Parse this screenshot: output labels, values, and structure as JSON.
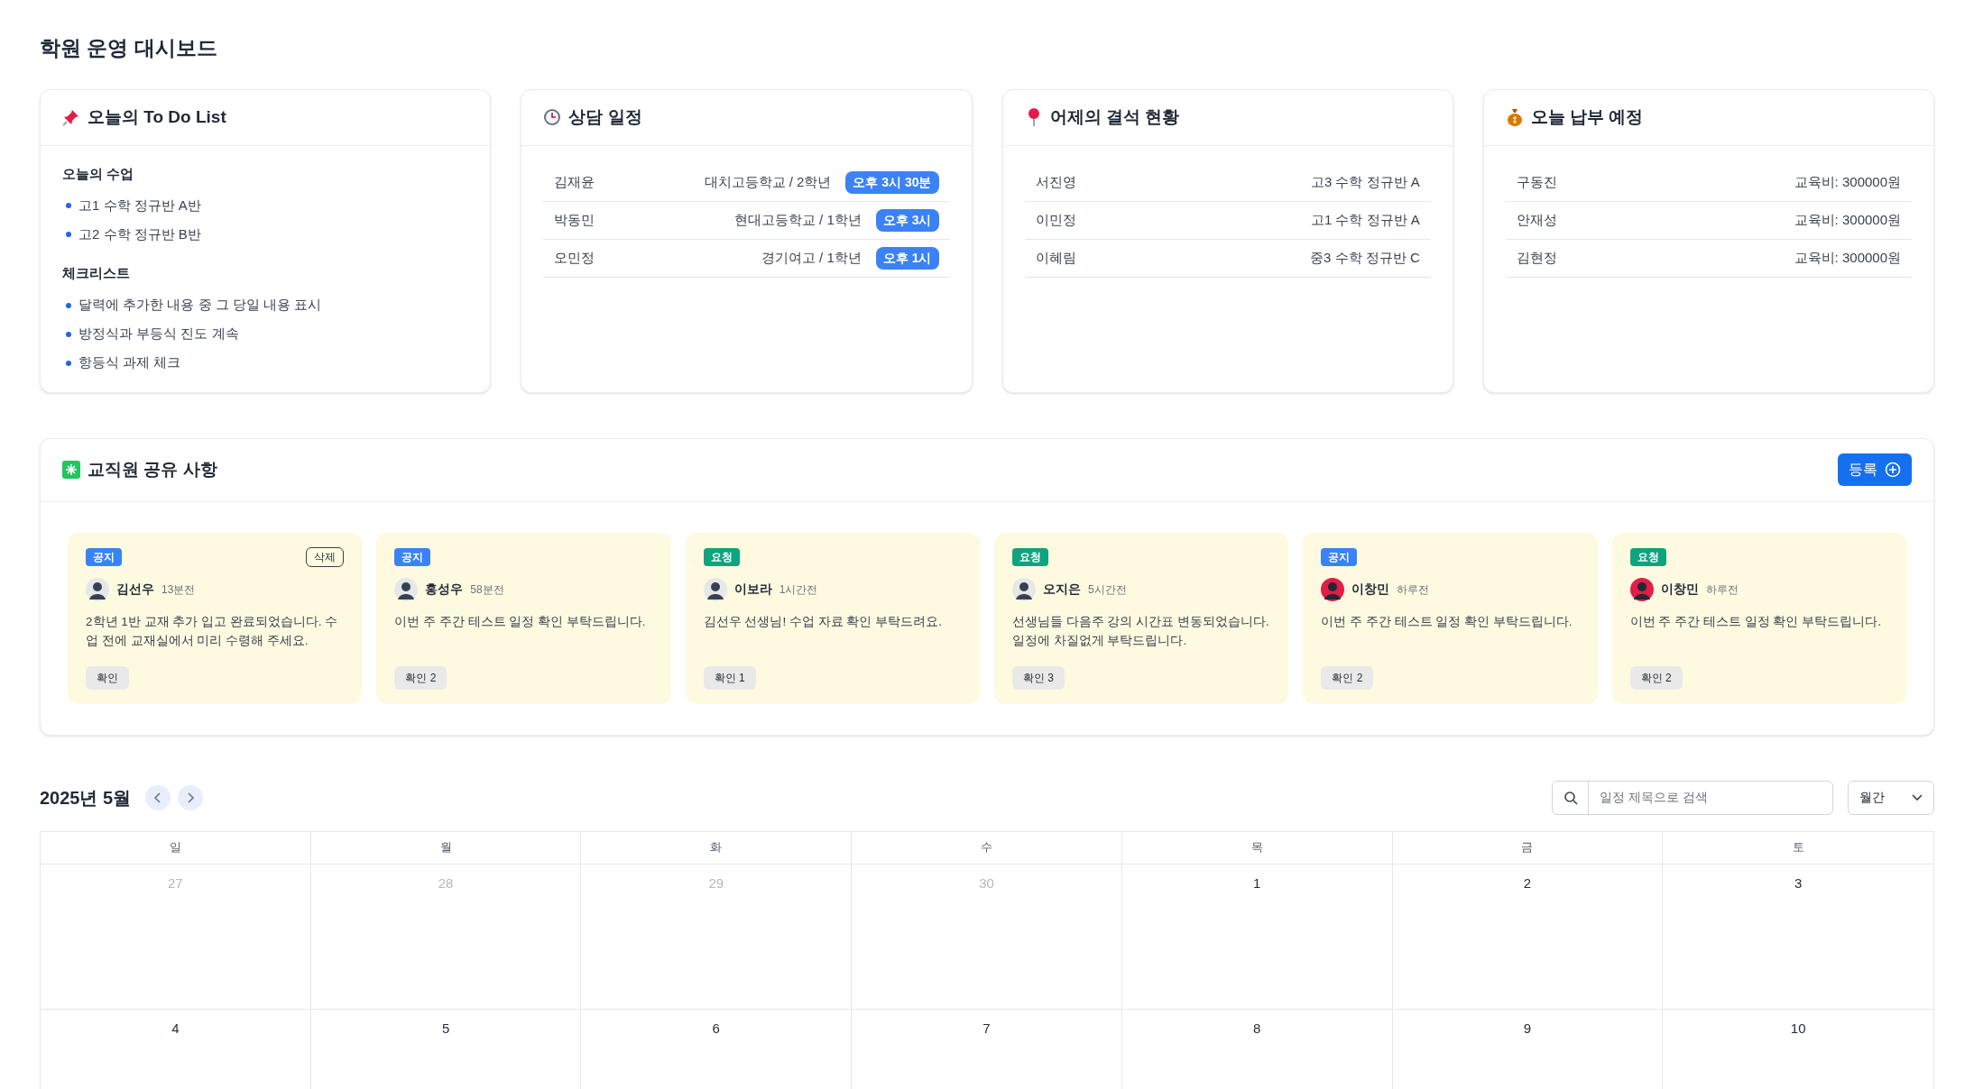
{
  "page_title": "학원 운영 대시보드",
  "todo": {
    "title": "오늘의 To Do List",
    "sections": [
      {
        "heading": "오늘의 수업",
        "items": [
          "고1 수학 정규반 A반",
          "고2 수학 정규반 B반"
        ]
      },
      {
        "heading": "체크리스트",
        "items": [
          "달력에 추가한 내용 중 그 당일 내용 표시",
          "방정식과 부등식 진도 계속",
          "항등식 과제 체크"
        ]
      }
    ]
  },
  "consult": {
    "title": "상담 일정",
    "rows": [
      {
        "name": "김재윤",
        "school": "대치고등학교 / 2학년",
        "time": "오후 3시 30분"
      },
      {
        "name": "박동민",
        "school": "현대고등학교 / 1학년",
        "time": "오후 3시"
      },
      {
        "name": "오민정",
        "school": "경기여고 / 1학년",
        "time": "오후 1시"
      }
    ]
  },
  "absence": {
    "title": "어제의 결석 현황",
    "rows": [
      {
        "name": "서진영",
        "value": "고3 수학 정규반 A"
      },
      {
        "name": "이민정",
        "value": "고1 수학 정규반 A"
      },
      {
        "name": "이혜림",
        "value": "중3 수학 정규반 C"
      }
    ]
  },
  "payment": {
    "title": "오늘 납부 예정",
    "rows": [
      {
        "name": "구동진",
        "value": "교육비: 300000원"
      },
      {
        "name": "안재성",
        "value": "교육비: 300000원"
      },
      {
        "name": "김현정",
        "value": "교육비: 300000원"
      }
    ]
  },
  "notices": {
    "title": "교직원 공유 사항",
    "register_button": "등록",
    "cards": [
      {
        "tag": "공지",
        "color": "#3b82f6",
        "delete_label": "삭제",
        "author": "김선우",
        "time": "13분전",
        "body": "2학년 1반 교재 추가 입고 완료되었습니다. 수업 전에 교재실에서 미리 수령해 주세요.",
        "confirm": "확인"
      },
      {
        "tag": "공지",
        "color": "#3b82f6",
        "author": "홍성우",
        "time": "58분전",
        "body": "이번 주 주간 테스트 일정 확인 부탁드립니다.",
        "confirm": "확인 2"
      },
      {
        "tag": "요청",
        "color": "#10a37f",
        "author": "이보라",
        "time": "1시간전",
        "body": "김선우 선생님! 수업 자료 확인 부탁드려요.",
        "confirm": "확인 1"
      },
      {
        "tag": "요청",
        "color": "#10a37f",
        "author": "오지은",
        "time": "5시간전",
        "body": "선생님들 다음주 강의 시간표 변동되었습니다. 일정에 차질없게 부탁드립니다.",
        "confirm": "확인 3"
      },
      {
        "tag": "공지",
        "color": "#3b82f6",
        "author": "이창민",
        "time": "하루전",
        "body": "이번 주 주간 테스트 일정 확인 부탁드립니다.",
        "confirm": "확인 2"
      },
      {
        "tag": "요청",
        "color": "#10a37f",
        "author": "이창민",
        "time": "하루전",
        "body": "이번 주 주간 테스트 일정 확인 부탁드립니다.",
        "confirm": "확인 2"
      }
    ]
  },
  "calendar": {
    "title": "2025년 5월",
    "search": {
      "placeholder": "일정 제목으로 검색"
    },
    "view_select": "월간",
    "weekdays": [
      "일",
      "월",
      "화",
      "수",
      "목",
      "금",
      "토"
    ],
    "weeks": [
      [
        {
          "day": "27",
          "muted": true
        },
        {
          "day": "28",
          "muted": true
        },
        {
          "day": "29",
          "muted": true
        },
        {
          "day": "30",
          "muted": true
        },
        {
          "day": "1",
          "muted": false
        },
        {
          "day": "2",
          "muted": false
        },
        {
          "day": "3",
          "muted": false
        }
      ],
      [
        {
          "day": "4",
          "muted": false
        },
        {
          "day": "5",
          "muted": false
        },
        {
          "day": "6",
          "muted": false
        },
        {
          "day": "7",
          "muted": false
        },
        {
          "day": "8",
          "muted": false
        },
        {
          "day": "9",
          "muted": false
        },
        {
          "day": "10",
          "muted": false
        }
      ]
    ]
  }
}
